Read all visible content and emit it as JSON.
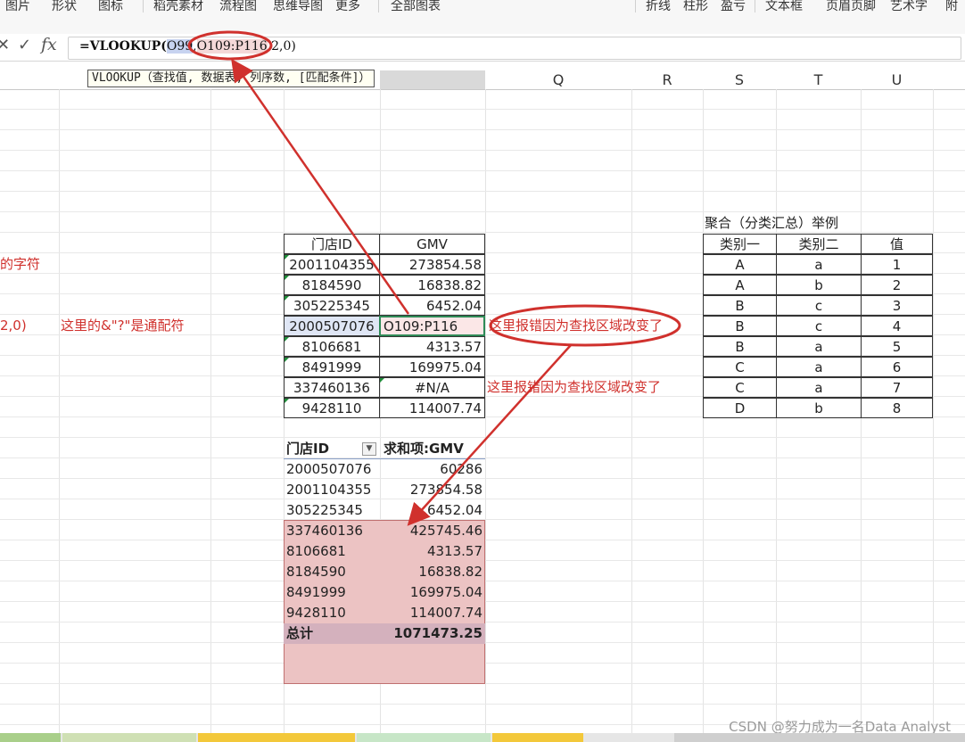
{
  "ribbon": {
    "items": [
      "图片",
      "形状",
      "图标",
      "稻壳素材",
      "流程图",
      "思维导图",
      "更多",
      "全部图表",
      "折线",
      "柱形",
      "盈亏",
      "文本框",
      "页眉页脚",
      "艺术字",
      "附"
    ]
  },
  "formula_bar": {
    "cancel_icon": "✕",
    "confirm_icon": "✓",
    "fx_label": "fx",
    "prefix": "=VLOOKUP(",
    "arg1": "O99",
    "comma1": ",",
    "arg2": "O109:P116",
    "rest": ",2,0)"
  },
  "tooltip": {
    "text": "VLOOKUP（查找值, 数据表, 列序数, [匹配条件]）"
  },
  "columns": [
    "Q",
    "R",
    "S",
    "T",
    "U"
  ],
  "left_notes": {
    "fragment1": "的字符",
    "fragment2": "2,0)",
    "wildcard_note": "这里的&\"?\"是通配符"
  },
  "table1": {
    "headers": [
      "门店ID",
      "GMV"
    ],
    "rows": [
      [
        "2001104355",
        "273854.58"
      ],
      [
        "8184590",
        "16838.82"
      ],
      [
        "305225345",
        "6452.04"
      ],
      [
        "2000507076",
        "O109:P116"
      ],
      [
        "8106681",
        "4313.57"
      ],
      [
        "8491999",
        "169975.04"
      ],
      [
        "337460136",
        "#N/A"
      ],
      [
        "9428110",
        "114007.74"
      ]
    ]
  },
  "annotations": {
    "error1": "这里报错因为查找区域改变了",
    "error2": "这里报错因为查找区域改变了"
  },
  "pivot": {
    "headers": [
      "门店ID",
      "求和项:GMV"
    ],
    "rows": [
      [
        "2000507076",
        "60286"
      ],
      [
        "2001104355",
        "273854.58"
      ],
      [
        "305225345",
        "6452.04"
      ],
      [
        "337460136",
        "425745.46"
      ],
      [
        "8106681",
        "4313.57"
      ],
      [
        "8184590",
        "16838.82"
      ],
      [
        "8491999",
        "169975.04"
      ],
      [
        "9428110",
        "114007.74"
      ]
    ],
    "total": [
      "总计",
      "1071473.25"
    ]
  },
  "aggregation": {
    "title": "聚合（分类汇总）举例",
    "headers": [
      "类别一",
      "类别二",
      "值"
    ],
    "rows": [
      [
        "A",
        "a",
        "1"
      ],
      [
        "A",
        "b",
        "2"
      ],
      [
        "B",
        "c",
        "3"
      ],
      [
        "B",
        "c",
        "4"
      ],
      [
        "B",
        "a",
        "5"
      ],
      [
        "C",
        "a",
        "6"
      ],
      [
        "C",
        "a",
        "7"
      ],
      [
        "D",
        "b",
        "8"
      ]
    ]
  },
  "watermark": "CSDN @努力成为一名Data Analyst",
  "colors": {
    "accent_red": "#d0312d",
    "pink_fill": "#ecc3c3",
    "total_fill": "#d4b1bd"
  }
}
